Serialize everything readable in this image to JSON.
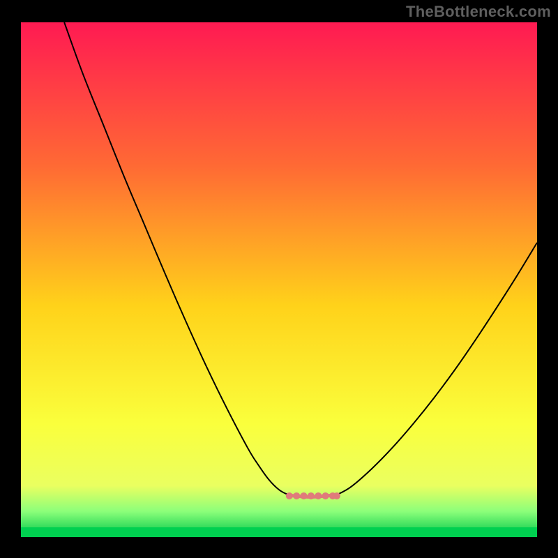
{
  "watermark": "TheBottleneck.com",
  "chart_data": {
    "type": "line",
    "title": "",
    "xlabel": "",
    "ylabel": "",
    "xlim": [
      0,
      100
    ],
    "ylim": [
      0,
      100
    ],
    "grid": false,
    "legend": false,
    "annotations": [],
    "background_gradient": {
      "top": "#ff1a52",
      "mid_upper": "#ff7a2e",
      "mid": "#ffd21a",
      "mid_lower": "#f8ff3a",
      "green_band": "#56ff6a",
      "bottom": "#00c84a"
    },
    "series": [
      {
        "name": "left-branch",
        "x": [
          8.4,
          12,
          16,
          20,
          24,
          28,
          32,
          36,
          40,
          44,
          46,
          48,
          50,
          51.8
        ],
        "y": [
          100,
          90,
          80,
          70,
          60.5,
          51,
          41.8,
          33,
          24.8,
          17.2,
          14,
          11.2,
          9.2,
          8.2
        ]
      },
      {
        "name": "floor-band",
        "x": [
          51.8,
          53,
          56,
          59,
          61.2
        ],
        "y": [
          8.2,
          8.0,
          7.8,
          8.0,
          8.2
        ]
      },
      {
        "name": "right-branch",
        "x": [
          61.2,
          64,
          68,
          72,
          76,
          80,
          84,
          88,
          92,
          96,
          100
        ],
        "y": [
          8.2,
          9.8,
          13.3,
          17.4,
          22.0,
          27.0,
          32.4,
          38.2,
          44.3,
          50.6,
          57.2
        ]
      }
    ],
    "floor_markers_x": [
      52.0,
      53.4,
      54.8,
      56.2,
      57.6,
      59.0,
      60.4,
      61.2
    ],
    "floor_markers_y": 8.0,
    "floor_marker_color": "#e07b7b"
  }
}
